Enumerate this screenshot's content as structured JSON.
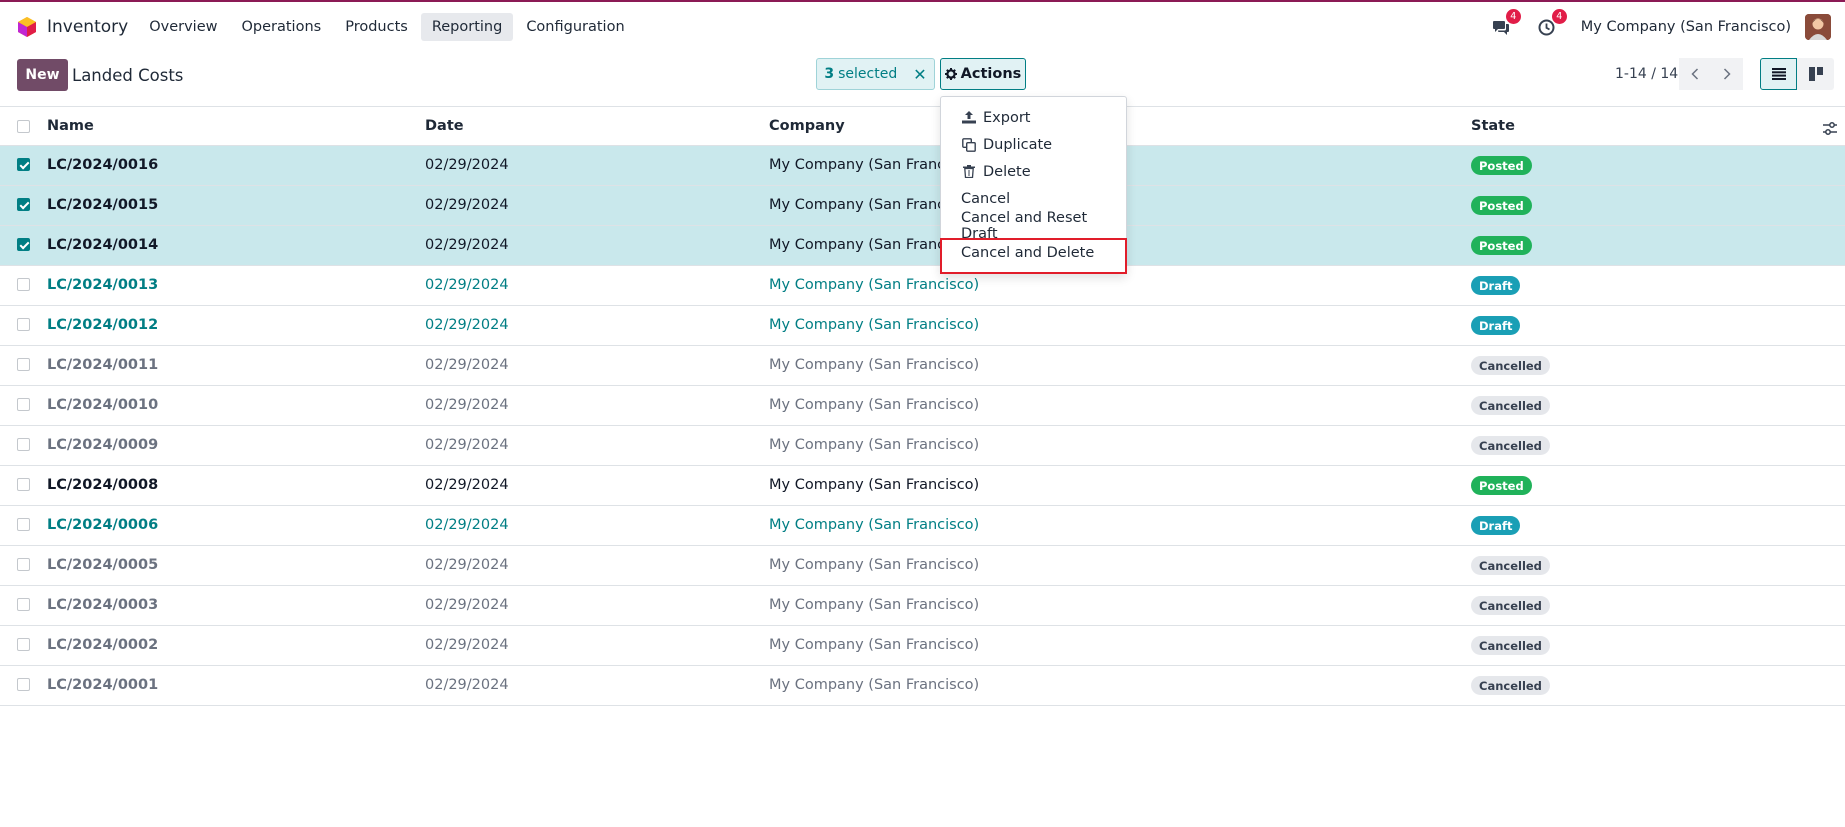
{
  "app": {
    "name": "Inventory",
    "menu": [
      "Overview",
      "Operations",
      "Products",
      "Reporting",
      "Configuration"
    ],
    "active_menu": "Reporting",
    "messages_badge": "4",
    "activities_badge": "4",
    "company": "My Company (San Francisco)"
  },
  "control": {
    "new_label": "New",
    "breadcrumb": "Landed Costs",
    "selected_count": "3",
    "selected_suffix": "selected",
    "actions_label": "Actions",
    "pager": "1-14 / 14"
  },
  "actions_menu": {
    "items": [
      {
        "label": "Export",
        "icon": "upload-icon"
      },
      {
        "label": "Duplicate",
        "icon": "copy-icon"
      },
      {
        "label": "Delete",
        "icon": "trash-icon"
      },
      {
        "label": "Cancel",
        "icon": ""
      },
      {
        "label": "Cancel and Reset Draft",
        "icon": ""
      },
      {
        "label": "Cancel and Delete",
        "icon": ""
      }
    ],
    "highlighted": "Cancel and Delete"
  },
  "table": {
    "columns": [
      "Name",
      "Date",
      "Company",
      "State"
    ],
    "rows": [
      {
        "name": "LC/2024/0016",
        "date": "02/29/2024",
        "company": "My Company (San Francisco)",
        "state": "Posted",
        "selected": true
      },
      {
        "name": "LC/2024/0015",
        "date": "02/29/2024",
        "company": "My Company (San Francisco)",
        "state": "Posted",
        "selected": true
      },
      {
        "name": "LC/2024/0014",
        "date": "02/29/2024",
        "company": "My Company (San Francisco)",
        "state": "Posted",
        "selected": true
      },
      {
        "name": "LC/2024/0013",
        "date": "02/29/2024",
        "company": "My Company (San Francisco)",
        "state": "Draft",
        "selected": false
      },
      {
        "name": "LC/2024/0012",
        "date": "02/29/2024",
        "company": "My Company (San Francisco)",
        "state": "Draft",
        "selected": false
      },
      {
        "name": "LC/2024/0011",
        "date": "02/29/2024",
        "company": "My Company (San Francisco)",
        "state": "Cancelled",
        "selected": false
      },
      {
        "name": "LC/2024/0010",
        "date": "02/29/2024",
        "company": "My Company (San Francisco)",
        "state": "Cancelled",
        "selected": false
      },
      {
        "name": "LC/2024/0009",
        "date": "02/29/2024",
        "company": "My Company (San Francisco)",
        "state": "Cancelled",
        "selected": false
      },
      {
        "name": "LC/2024/0008",
        "date": "02/29/2024",
        "company": "My Company (San Francisco)",
        "state": "Posted",
        "selected": false
      },
      {
        "name": "LC/2024/0006",
        "date": "02/29/2024",
        "company": "My Company (San Francisco)",
        "state": "Draft",
        "selected": false
      },
      {
        "name": "LC/2024/0005",
        "date": "02/29/2024",
        "company": "My Company (San Francisco)",
        "state": "Cancelled",
        "selected": false
      },
      {
        "name": "LC/2024/0003",
        "date": "02/29/2024",
        "company": "My Company (San Francisco)",
        "state": "Cancelled",
        "selected": false
      },
      {
        "name": "LC/2024/0002",
        "date": "02/29/2024",
        "company": "My Company (San Francisco)",
        "state": "Cancelled",
        "selected": false
      },
      {
        "name": "LC/2024/0001",
        "date": "02/29/2024",
        "company": "My Company (San Francisco)",
        "state": "Cancelled",
        "selected": false
      }
    ]
  },
  "colors": {
    "brand": "#714b67",
    "accent": "#017e84",
    "selected_row": "#c9e8ec",
    "posted": "#20b25a",
    "draft": "#1a9fb5",
    "highlight_border": "#e11d2a"
  }
}
